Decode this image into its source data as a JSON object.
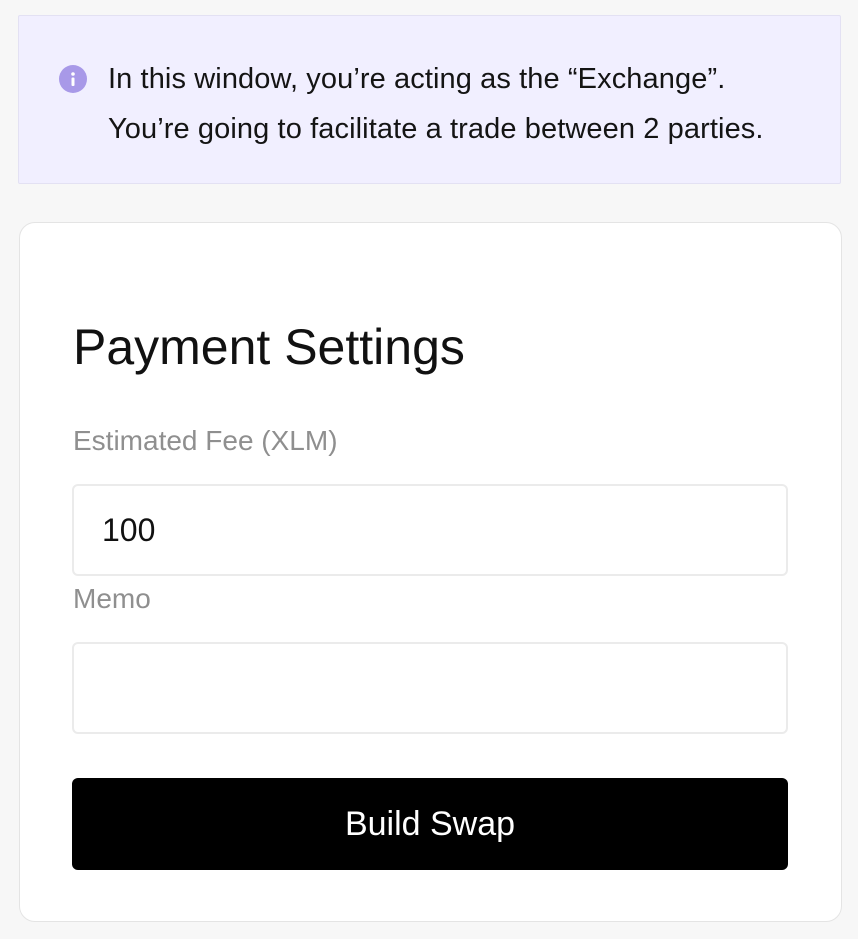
{
  "notice": {
    "icon": "info-icon",
    "icon_color": "#a899e8",
    "background_color": "#f1efff",
    "line1": "In this window, you’re acting as the “Exchange”.",
    "line2": "You’re going to facilitate a trade between 2 parties."
  },
  "payment_settings": {
    "title": "Payment Settings",
    "fee_label": "Estimated Fee (XLM)",
    "fee_value": "100",
    "memo_label": "Memo",
    "memo_value": "",
    "build_button_label": "Build Swap"
  }
}
